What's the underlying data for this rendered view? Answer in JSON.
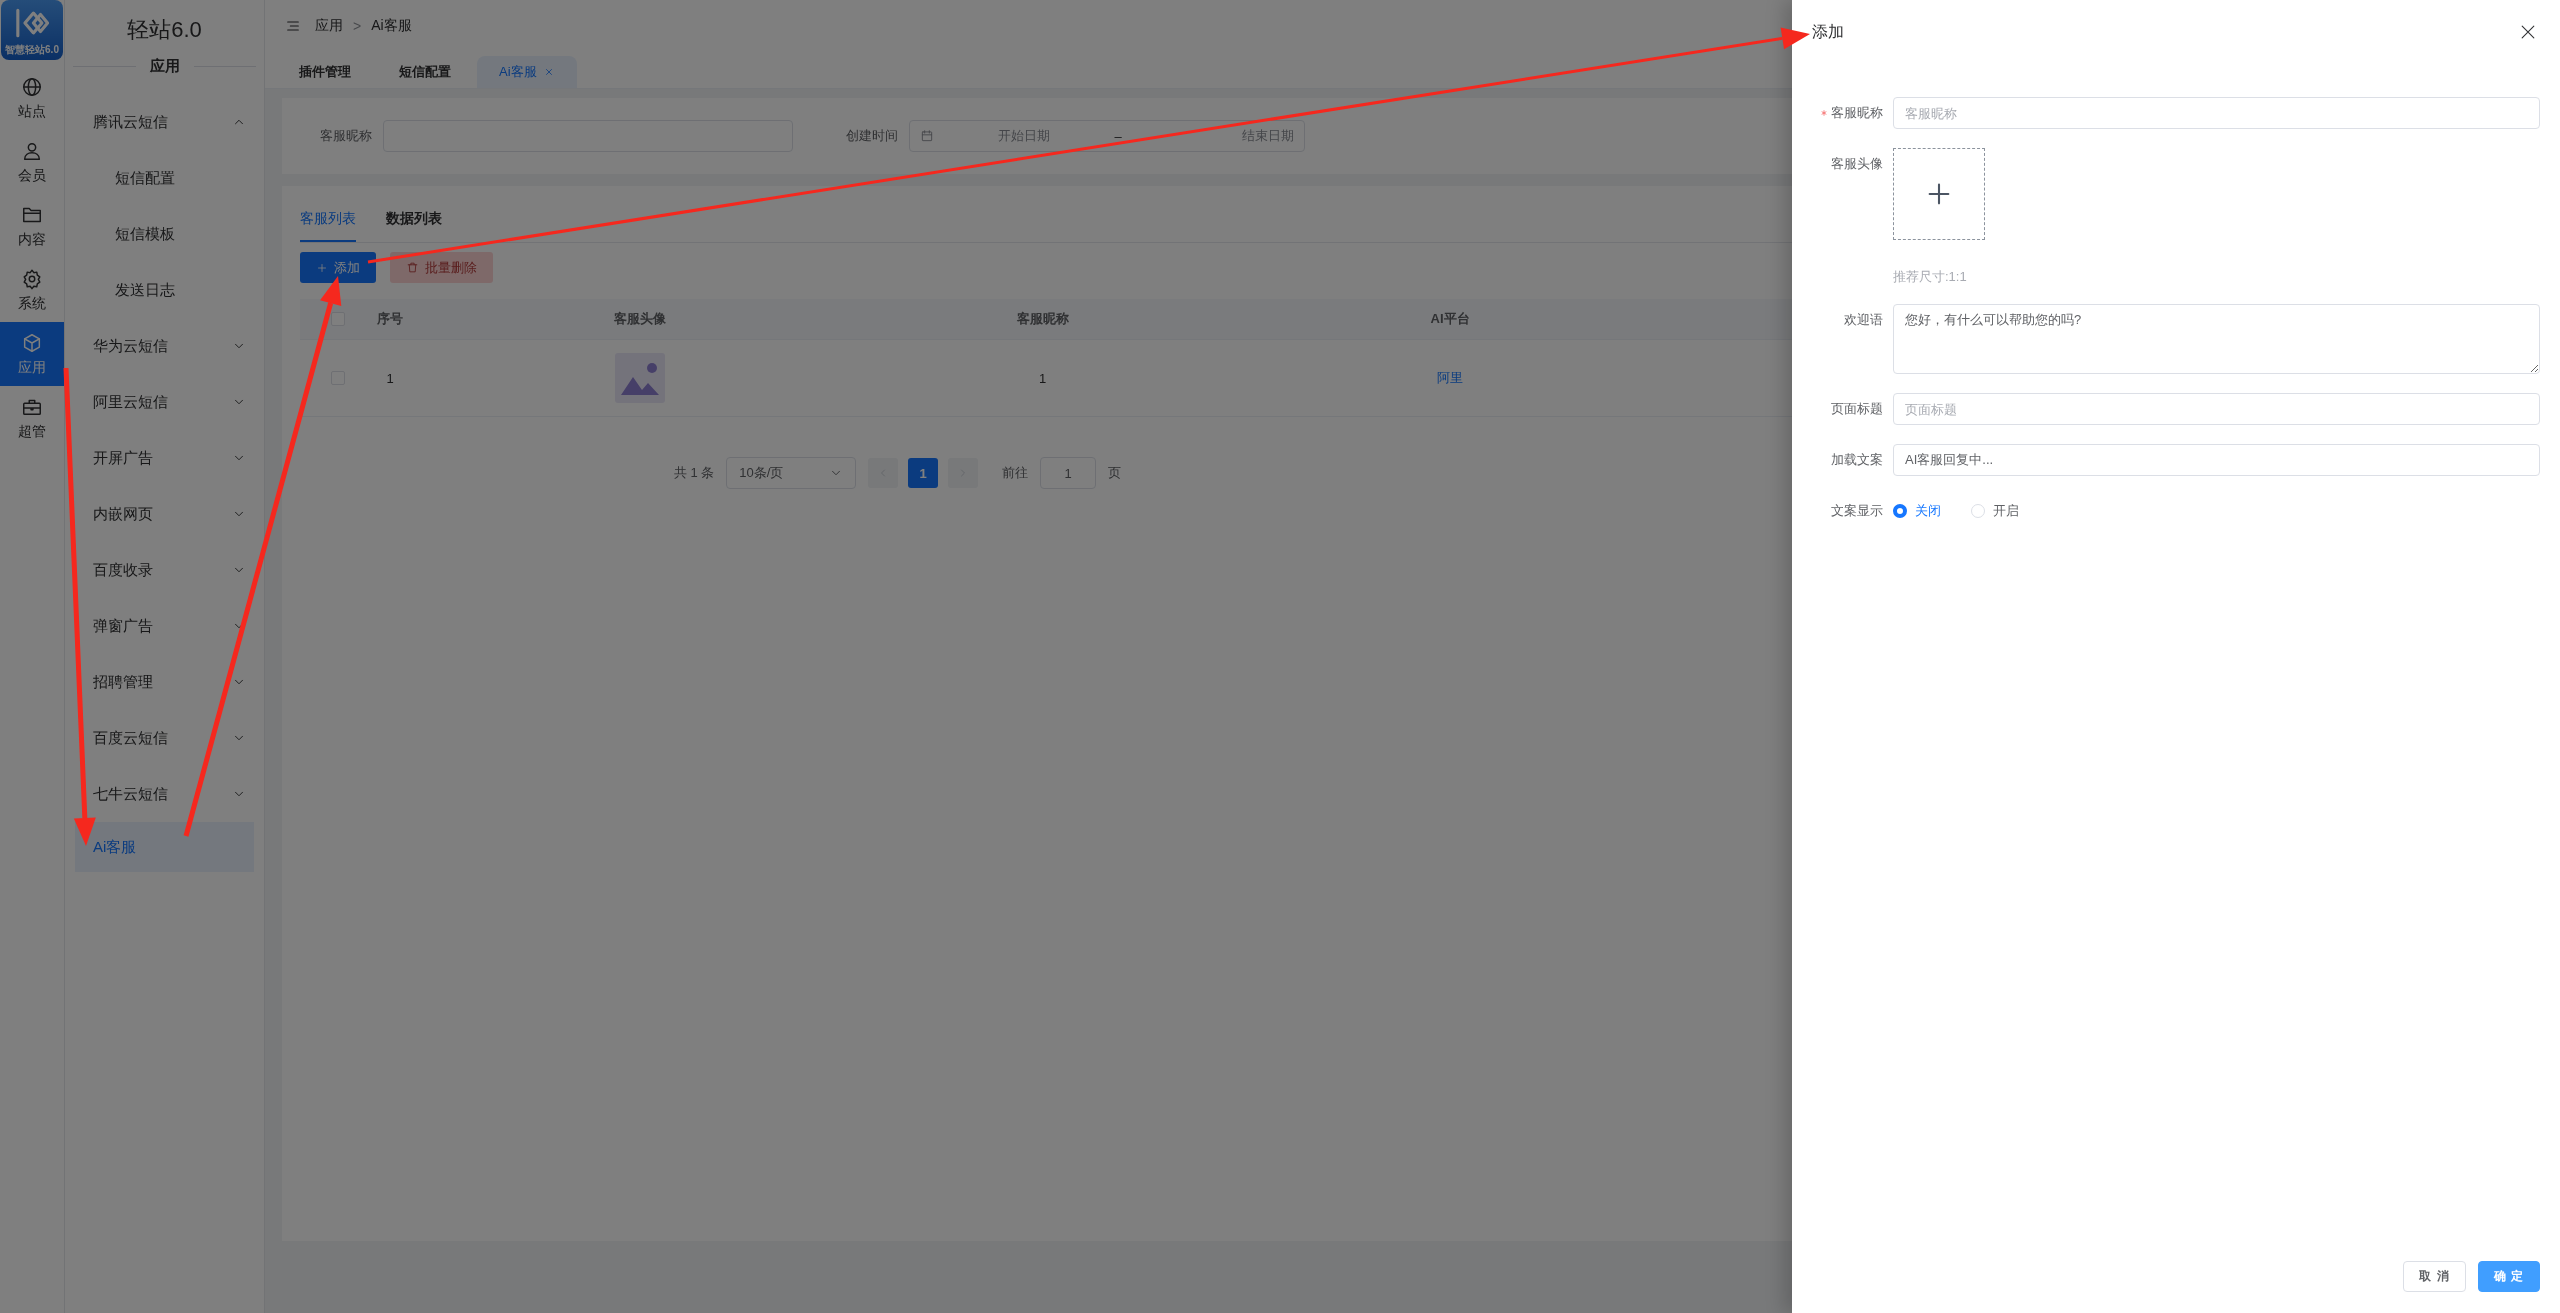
{
  "rail": {
    "logo_text": "智慧轻站6.0",
    "items": [
      {
        "label": "站点",
        "selected": false
      },
      {
        "label": "会员",
        "selected": false
      },
      {
        "label": "内容",
        "selected": false
      },
      {
        "label": "系统",
        "selected": false
      },
      {
        "label": "应用",
        "selected": true
      },
      {
        "label": "超管",
        "selected": false
      }
    ]
  },
  "sidebar": {
    "title": "轻站6.0",
    "section": "应用",
    "items": [
      {
        "label": "腾讯云短信",
        "kind": "group",
        "expanded": true,
        "selected": false,
        "children": [
          {
            "label": "短信配置",
            "selected": false
          },
          {
            "label": "短信模板",
            "selected": false
          },
          {
            "label": "发送日志",
            "selected": false
          }
        ]
      },
      {
        "label": "华为云短信",
        "kind": "group",
        "expanded": false,
        "selected": false
      },
      {
        "label": "阿里云短信",
        "kind": "group",
        "expanded": false,
        "selected": false
      },
      {
        "label": "开屏广告",
        "kind": "group",
        "expanded": false,
        "selected": false
      },
      {
        "label": "内嵌网页",
        "kind": "group",
        "expanded": false,
        "selected": false
      },
      {
        "label": "百度收录",
        "kind": "group",
        "expanded": false,
        "selected": false
      },
      {
        "label": "弹窗广告",
        "kind": "group",
        "expanded": false,
        "selected": false
      },
      {
        "label": "招聘管理",
        "kind": "group",
        "expanded": false,
        "selected": false
      },
      {
        "label": "百度云短信",
        "kind": "group",
        "expanded": false,
        "selected": false
      },
      {
        "label": "七牛云短信",
        "kind": "group",
        "expanded": false,
        "selected": false
      },
      {
        "label": "Ai客服",
        "kind": "link",
        "selected": true
      }
    ]
  },
  "breadcrumb": {
    "items": [
      "应用",
      "Ai客服"
    ],
    "separator": ">"
  },
  "tabs": [
    {
      "label": "插件管理",
      "selected": false,
      "closable": false
    },
    {
      "label": "短信配置",
      "selected": false,
      "closable": false
    },
    {
      "label": "Ai客服",
      "selected": true,
      "closable": true
    }
  ],
  "filters": {
    "nickname": {
      "label": "客服昵称"
    },
    "created": {
      "label": "创建时间",
      "start_placeholder": "开始日期",
      "separator": "–",
      "end_placeholder": "结束日期"
    }
  },
  "list_tabs": [
    {
      "label": "客服列表",
      "selected": true
    },
    {
      "label": "数据列表",
      "selected": false
    }
  ],
  "actions": [
    {
      "label": "添加",
      "kind": "primary",
      "disabled": false
    },
    {
      "label": "批量删除",
      "kind": "danger",
      "disabled": true
    }
  ],
  "table": {
    "all_checked": false,
    "columns": [
      "序号",
      "客服头像",
      "客服昵称",
      "AI平台"
    ],
    "rows": [
      {
        "checked": false,
        "index": "1",
        "nickname": "1",
        "platform": "阿里"
      }
    ]
  },
  "pagination": {
    "total": "共 1 条",
    "page_size": "10条/页",
    "pages": [
      {
        "label": "1",
        "selected": true
      }
    ],
    "goto_label": "前往",
    "goto_value": "1",
    "page_suffix": "页"
  },
  "drawer": {
    "title": "添加",
    "fields": [
      {
        "kind": "input",
        "label": "客服昵称",
        "required": true,
        "placeholder": "客服昵称"
      },
      {
        "kind": "upload",
        "label": "客服头像",
        "required": false,
        "hint": "推荐尺寸:1:1"
      },
      {
        "kind": "textarea",
        "label": "欢迎语",
        "required": false,
        "value": "您好，有什么可以帮助您的吗?"
      },
      {
        "kind": "input",
        "label": "页面标题",
        "required": false,
        "placeholder": "页面标题"
      },
      {
        "kind": "input",
        "label": "加载文案",
        "required": false,
        "value": "AI客服回复中..."
      },
      {
        "kind": "radio",
        "label": "文案显示",
        "required": false,
        "options": [
          {
            "label": "关闭",
            "selected": true
          },
          {
            "label": "开启",
            "selected": false
          }
        ]
      }
    ],
    "buttons": [
      {
        "label": "取 消",
        "kind": "default"
      },
      {
        "label": "确 定",
        "kind": "primary"
      }
    ]
  }
}
